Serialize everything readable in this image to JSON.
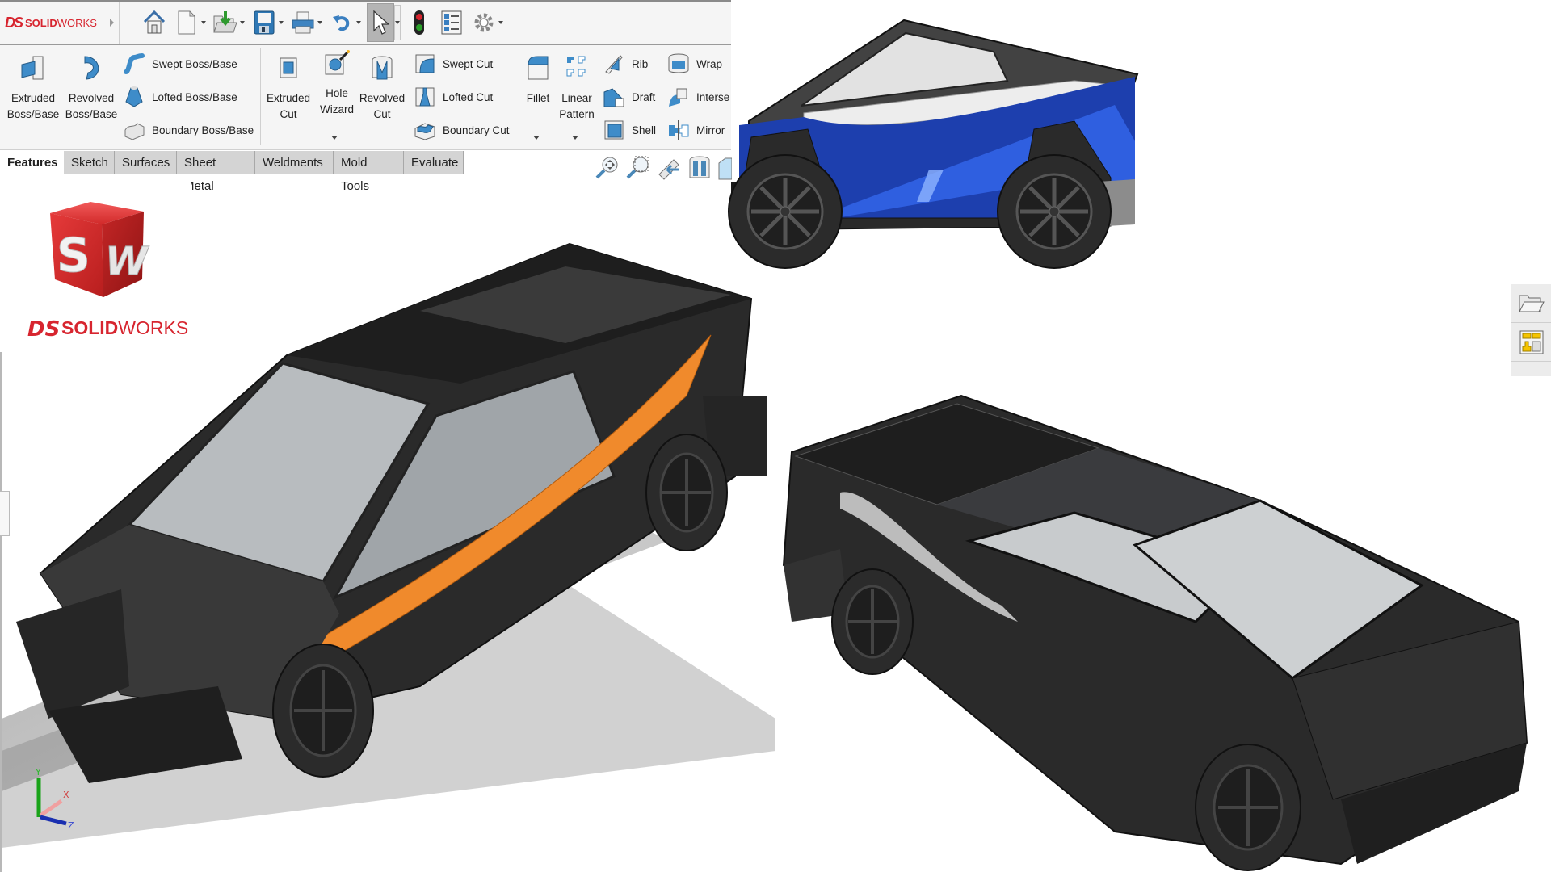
{
  "app": {
    "brand": {
      "prefix": "DS",
      "bold": "SOLID",
      "light": "WORKS"
    },
    "logo": {
      "cube_letters": [
        "S",
        "W"
      ],
      "wordmark_bold": "SOLID",
      "wordmark_light": "WORKS",
      "accent": "#d7252f"
    }
  },
  "toolbar": {
    "buttons": [
      {
        "name": "home",
        "icon": "home-icon",
        "has_dropdown": false
      },
      {
        "name": "new",
        "icon": "new-document-icon",
        "has_dropdown": true
      },
      {
        "name": "open",
        "icon": "open-folder-icon",
        "has_dropdown": true
      },
      {
        "name": "save",
        "icon": "save-icon",
        "has_dropdown": true
      },
      {
        "name": "print",
        "icon": "print-icon",
        "has_dropdown": true
      },
      {
        "name": "undo",
        "icon": "undo-icon",
        "has_dropdown": true
      },
      {
        "name": "select",
        "icon": "cursor-icon",
        "has_dropdown": true,
        "active": true
      },
      {
        "name": "rebuild",
        "icon": "traffic-light-icon",
        "has_dropdown": false
      },
      {
        "name": "file-properties",
        "icon": "list-icon",
        "has_dropdown": false
      },
      {
        "name": "options",
        "icon": "gear-icon",
        "has_dropdown": true
      }
    ]
  },
  "ribbon": {
    "boss": {
      "extruded": "Extruded Boss/Base",
      "extruded_l1": "Extruded",
      "extruded_l2": "Boss/Base",
      "revolved_l1": "Revolved",
      "revolved_l2": "Boss/Base",
      "swept": "Swept Boss/Base",
      "lofted": "Lofted Boss/Base",
      "boundary": "Boundary Boss/Base"
    },
    "cut": {
      "extruded_l1": "Extruded",
      "extruded_l2": "Cut",
      "hole_l1": "Hole",
      "hole_l2": "Wizard",
      "revolved_l1": "Revolved",
      "revolved_l2": "Cut",
      "swept": "Swept Cut",
      "lofted": "Lofted Cut",
      "boundary": "Boundary Cut"
    },
    "features": {
      "fillet": "Fillet",
      "linear_l1": "Linear",
      "linear_l2": "Pattern",
      "rib": "Rib",
      "draft": "Draft",
      "shell": "Shell",
      "wrap": "Wrap",
      "intersect": "Interse",
      "mirror": "Mirror"
    }
  },
  "tabs": [
    {
      "label": "Features",
      "active": true
    },
    {
      "label": "Sketch"
    },
    {
      "label": "Surfaces"
    },
    {
      "label": "Sheet Metal"
    },
    {
      "label": "Weldments"
    },
    {
      "label": "Mold Tools"
    },
    {
      "label": "Evaluate"
    }
  ],
  "view_tools": [
    "zoom-to-fit-icon",
    "zoom-to-area-icon",
    "previous-view-icon",
    "section-view-icon",
    "view-orientation-icon"
  ],
  "task_pane": [
    "file-explorer-icon",
    "view-palette-icon"
  ],
  "triad": {
    "x": "X",
    "y": "Y",
    "z": "Z"
  },
  "scene": {
    "models": [
      {
        "name": "cybertruck-side-view",
        "body_color": "#1f3fb0"
      },
      {
        "name": "cybertruck-front-iso-view",
        "accent_color": "#f08a2c"
      },
      {
        "name": "cybertruck-rear-iso-view",
        "body_color": "#2a2a2a"
      }
    ]
  }
}
